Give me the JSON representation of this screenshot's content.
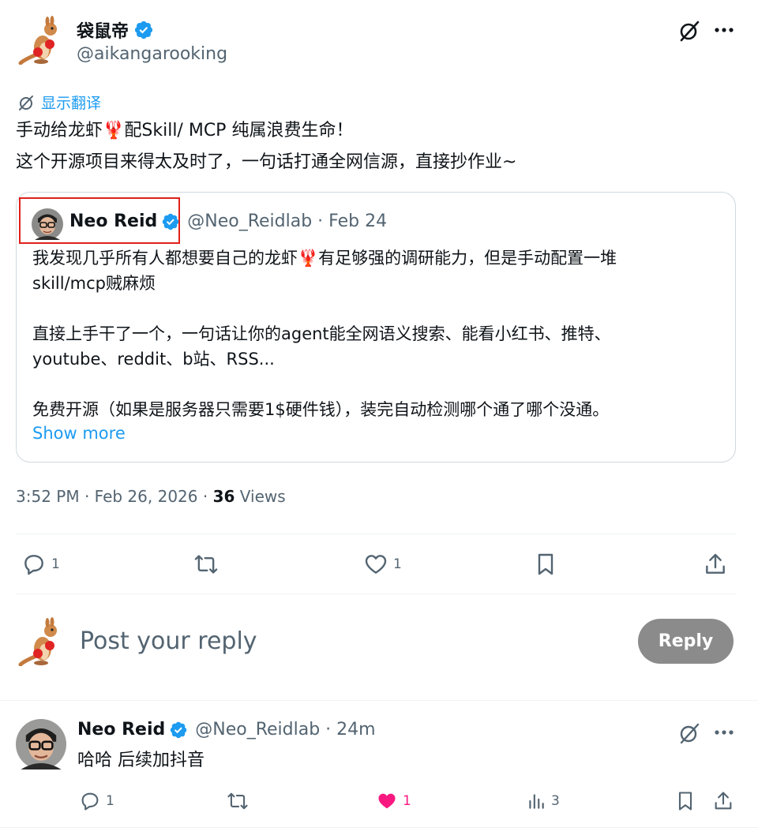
{
  "tweet": {
    "author_name": "袋鼠帝",
    "author_handle": "@aikangarooking",
    "translate_label": "显示翻译",
    "text_line1": "手动给龙虾🦞配Skill/ MCP 纯属浪费生命！",
    "text_line2": "这个开源项目来得太及时了，一句话打通全网信源，直接抄作业~",
    "time": "3:52 PM · Feb 26, 2026 · ",
    "views_count": "36",
    "views_label": " Views",
    "actions": {
      "reply_count": "1",
      "like_count": "1"
    }
  },
  "quote": {
    "author_name": "Neo Reid",
    "author_handle": "@Neo_Reidlab · Feb 24",
    "line1": "我发现几乎所有人都想要自己的龙虾🦞有足够强的调研能力，但是手动配置一堆",
    "line2": "skill/mcp贼麻烦",
    "line3": "直接上手干了一个，一句话让你的agent能全网语义搜索、能看小红书、推特、",
    "line4": "youtube、reddit、b站、RSS...",
    "line5": "免费开源（如果是服务器只需要1$硬件钱），装完自动检测哪个通了哪个没通。",
    "show_more": "Show more"
  },
  "reply_box": {
    "placeholder": "Post your reply",
    "button": "Reply"
  },
  "reply": {
    "author_name": "Neo Reid",
    "author_handle": "@Neo_Reidlab · 24m",
    "text": "哈哈 后续加抖音",
    "reply_count": "1",
    "like_count": "1",
    "views_count": "3"
  },
  "colors": {
    "accent": "#1d9bf0",
    "like": "#f91880",
    "highlight_box": "#e0201b"
  }
}
